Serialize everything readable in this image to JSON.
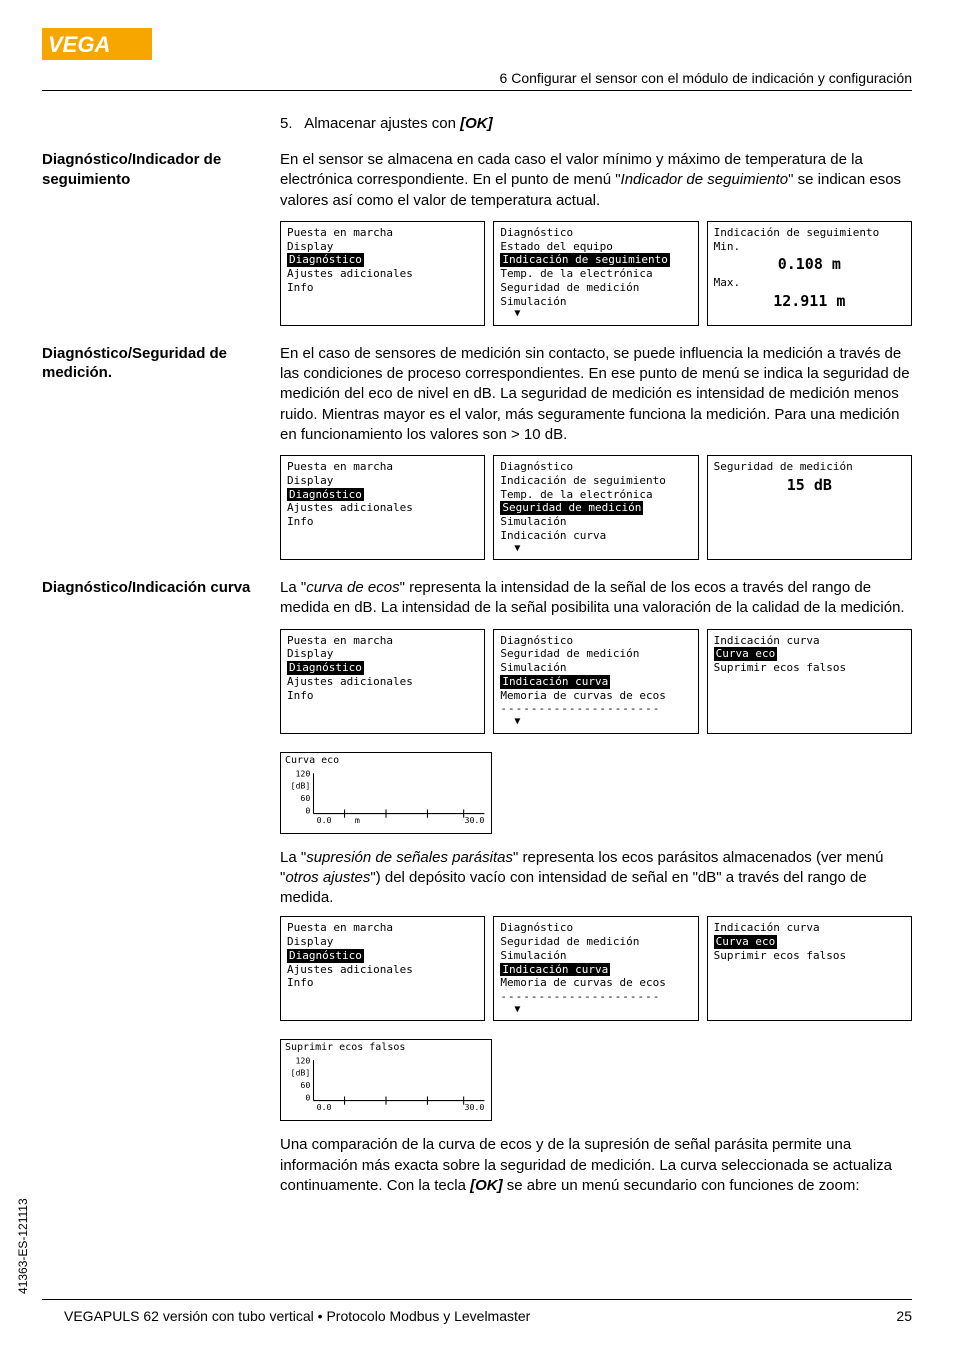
{
  "logo_text": "VEGA",
  "header": "6 Configurar el sensor con el módulo de indicación y configuración",
  "step": {
    "num": "5.",
    "text_pre": "Almacenar ajustes con ",
    "ok": "[OK]"
  },
  "sections": [
    {
      "heading": "Diagnóstico/Indicador de seguimiento",
      "para": [
        "En el sensor se almacena en cada caso el valor mínimo y máximo de temperatura de la electrónica correspondiente. En el punto de menú \"",
        "Indicador de seguimiento",
        "\" se indican esos valores así como el valor de temperatura actual."
      ],
      "lcds": [
        {
          "lines": [
            {
              "t": "Puesta en marcha"
            },
            {
              "t": "Display"
            },
            {
              "t": "Diagnóstico",
              "sel": true
            },
            {
              "t": "Ajustes adicionales"
            },
            {
              "t": "Info"
            }
          ]
        },
        {
          "lines": [
            {
              "t": "Diagnóstico"
            },
            {
              "t": " Estado del equipo"
            },
            {
              "t": "Indicación de seguimiento",
              "sel": true,
              "indent": true
            },
            {
              "t": " Temp. de la electrónica"
            },
            {
              "t": " Seguridad de medición"
            },
            {
              "t": " Simulación"
            }
          ],
          "arrow": "▼"
        },
        {
          "lines": [
            {
              "t": "Indicación de seguimiento"
            },
            {
              "t": "Min."
            },
            {
              "big": "0.108 m"
            },
            {
              "t": "Max."
            },
            {
              "big": "12.911 m"
            }
          ]
        }
      ]
    },
    {
      "heading": "Diagnóstico/Seguridad de medición.",
      "para": [
        "En el caso de sensores de medición sin contacto, se puede influencia la medición a través de las condiciones de proceso correspondientes. En ese punto de menú se indica la seguridad de medición del eco de nivel en dB. La seguridad de medición es intensidad de medición menos ruido. Mientras mayor es el valor, más seguramente funciona la medición. Para una medición en funcionamiento los valores son > 10 dB."
      ],
      "lcds": [
        {
          "lines": [
            {
              "t": "Puesta en marcha"
            },
            {
              "t": "Display"
            },
            {
              "t": "Diagnóstico",
              "sel": true
            },
            {
              "t": "Ajustes adicionales"
            },
            {
              "t": "Info"
            }
          ]
        },
        {
          "lines": [
            {
              "t": "Diagnóstico"
            },
            {
              "t": " Indicación de seguimiento"
            },
            {
              "t": " Temp. de la electrónica"
            },
            {
              "t": "Seguridad de medición",
              "sel": true,
              "indent": true
            },
            {
              "t": " Simulación"
            },
            {
              "t": " Indicación curva"
            }
          ],
          "arrow": "▼"
        },
        {
          "lines": [
            {
              "t": "Seguridad de medición"
            },
            {
              "t": ""
            },
            {
              "big": "15 dB"
            }
          ]
        }
      ]
    },
    {
      "heading": "Diagnóstico/Indicación curva",
      "para": [
        "La \"",
        "curva de ecos",
        "\" representa la intensidad de la señal de los ecos a través del rango de medida en dB. La intensidad de la señal posibilita una valoración de la calidad de la medición."
      ],
      "lcds": [
        {
          "lines": [
            {
              "t": "Puesta en marcha"
            },
            {
              "t": "Display"
            },
            {
              "t": "Diagnóstico",
              "sel": true
            },
            {
              "t": "Ajustes adicionales"
            },
            {
              "t": "Info"
            }
          ]
        },
        {
          "lines": [
            {
              "t": "Diagnóstico"
            },
            {
              "t": " Seguridad de medición"
            },
            {
              "t": " Simulación"
            },
            {
              "t": "Indicación curva",
              "sel": true,
              "indent": true
            },
            {
              "t": " Memoria de curvas de ecos"
            },
            {
              "dashes": true
            }
          ],
          "arrow": "▼"
        },
        {
          "lines": [
            {
              "t": "Indicación curva"
            },
            {
              "t": ""
            },
            {
              "t": "Curva eco",
              "sel": true
            },
            {
              "t": "Suprimir ecos falsos"
            }
          ]
        }
      ],
      "graph": {
        "title": "Curva eco",
        "y1": "120",
        "y2": "[dB]",
        "y3": "60",
        "x1": "0.0",
        "x2": "m",
        "x3": "30.0"
      },
      "para2": [
        "La \"",
        "supresión de señales parásitas",
        "\" representa los ecos parásitos almacenados (ver menú \"",
        "otros ajustes",
        "\") del depósito vacío con intensidad de señal en \"dB\" a través del rango de medida."
      ],
      "lcds2": [
        {
          "lines": [
            {
              "t": "Puesta en marcha"
            },
            {
              "t": "Display"
            },
            {
              "t": "Diagnóstico",
              "sel": true
            },
            {
              "t": "Ajustes adicionales"
            },
            {
              "t": "Info"
            }
          ]
        },
        {
          "lines": [
            {
              "t": "Diagnóstico"
            },
            {
              "t": " Seguridad de medición"
            },
            {
              "t": " Simulación"
            },
            {
              "t": "Indicación curva",
              "sel": true,
              "indent": true
            },
            {
              "t": " Memoria de curvas de ecos"
            },
            {
              "dashes": true
            }
          ],
          "arrow": "▼"
        },
        {
          "lines": [
            {
              "t": "Indicación curva"
            },
            {
              "t": ""
            },
            {
              "t": "Curva eco",
              "sel": true
            },
            {
              "t": "Suprimir ecos falsos"
            }
          ]
        }
      ],
      "graph2": {
        "title": "Suprimir ecos falsos",
        "y1": "120",
        "y2": "[dB]",
        "y3": "60",
        "x1": "0.0",
        "x3": "30.0"
      },
      "para3_pre": "Una comparación de la curva de ecos y de la supresión de señal parásita permite una información más exacta sobre la seguridad de medición. La curva seleccionada se actualiza continuamente. Con la tecla ",
      "para3_ok": "[OK]",
      "para3_post": " se abre un menú secundario con funciones de zoom:"
    }
  ],
  "footer": "VEGAPULS 62 versión con tubo vertical • Protocolo Modbus y Levelmaster",
  "page": "25",
  "side_code": "41363-ES-121113"
}
